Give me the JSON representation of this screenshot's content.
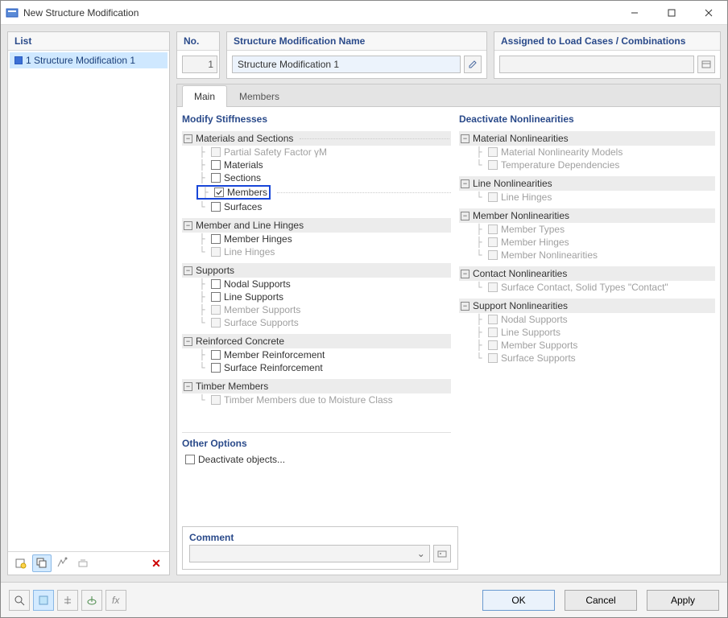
{
  "window": {
    "title": "New Structure Modification"
  },
  "left": {
    "header": "List",
    "items": [
      {
        "label": "1 Structure Modification 1"
      }
    ]
  },
  "top": {
    "no_label": "No.",
    "no_value": "1",
    "name_label": "Structure Modification Name",
    "name_value": "Structure Modification 1",
    "assign_label": "Assigned to Load Cases / Combinations",
    "assign_value": ""
  },
  "tabs": {
    "main": "Main",
    "members": "Members",
    "active": "main"
  },
  "modify": {
    "header": "Modify Stiffnesses",
    "g_mat": "Materials and Sections",
    "psf": "Partial Safety Factor γM",
    "materials": "Materials",
    "sections": "Sections",
    "members": "Members",
    "surfaces": "Surfaces",
    "g_mlh": "Member and Line Hinges",
    "member_hinges": "Member Hinges",
    "line_hinges": "Line Hinges",
    "g_supports": "Supports",
    "nodal_sup": "Nodal Supports",
    "line_sup": "Line Supports",
    "member_sup": "Member Supports",
    "surface_sup": "Surface Supports",
    "g_rc": "Reinforced Concrete",
    "rc_member": "Member Reinforcement",
    "rc_surface": "Surface Reinforcement",
    "g_timber": "Timber Members",
    "timber_moist": "Timber Members due to Moisture Class"
  },
  "other": {
    "header": "Other Options",
    "deactivate": "Deactivate objects..."
  },
  "deact": {
    "header": "Deactivate Nonlinearities",
    "g_mat": "Material Nonlinearities",
    "mat_models": "Material Nonlinearity Models",
    "temp_dep": "Temperature Dependencies",
    "g_line": "Line Nonlinearities",
    "line_hinges": "Line Hinges",
    "g_member": "Member Nonlinearities",
    "mem_types": "Member Types",
    "mem_hinges": "Member Hinges",
    "mem_nl": "Member Nonlinearities",
    "g_contact": "Contact Nonlinearities",
    "contact": "Surface Contact, Solid Types \"Contact\"",
    "g_support": "Support Nonlinearities",
    "sup_nodal": "Nodal Supports",
    "sup_line": "Line Supports",
    "sup_member": "Member Supports",
    "sup_surface": "Surface Supports"
  },
  "comment": {
    "header": "Comment",
    "value": ""
  },
  "footer": {
    "ok": "OK",
    "cancel": "Cancel",
    "apply": "Apply"
  }
}
